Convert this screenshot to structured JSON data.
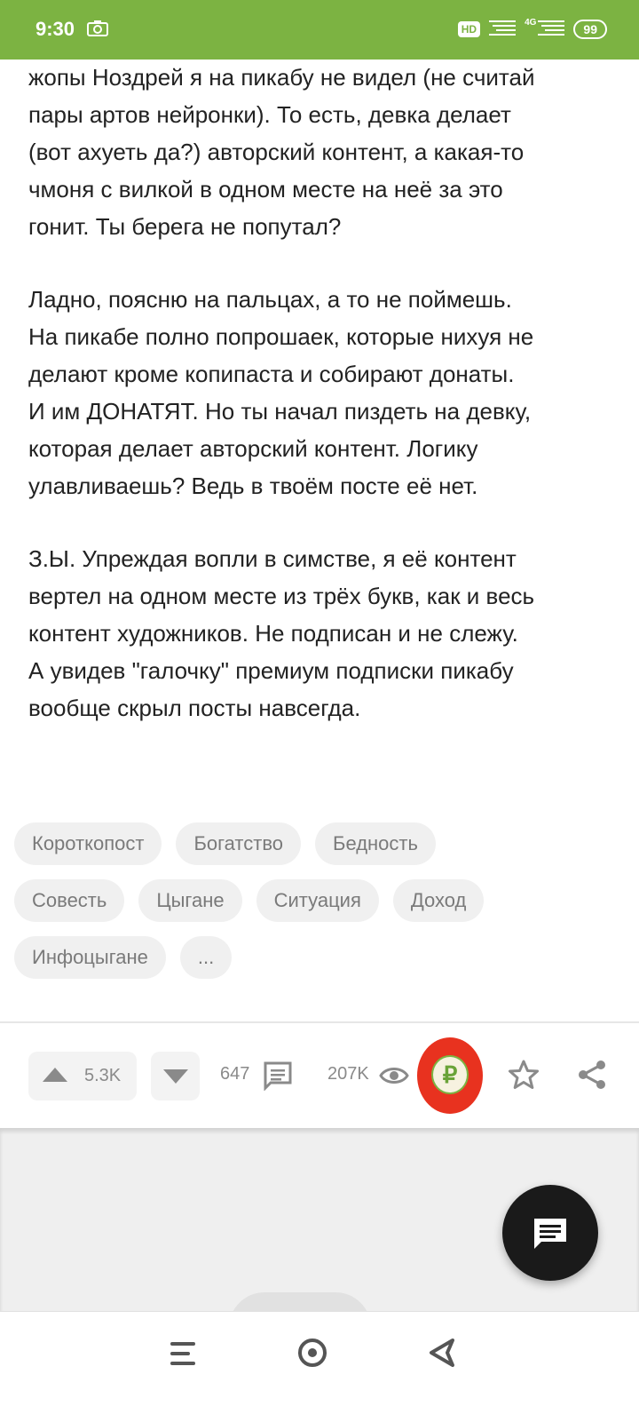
{
  "status_bar": {
    "time": "9:30",
    "hd": "HD",
    "network": "4G",
    "battery": "99"
  },
  "content": {
    "paragraphs": [
      "жопы Ноздрей я на пикабу не видел (не считай\nпары артов нейронки). То есть, девка делает\n(вот ахуеть да?) авторский контент, а какая-то\nчмоня с вилкой в одном месте на неё за это\nгонит. Ты берега не попутал?",
      "Ладно, поясню на пальцах, а то не поймешь.\nНа пикабе полно попрошаек, которые нихуя не\nделают кроме копипаста и собирают донаты.\nИ им ДОНАТЯТ. Но ты начал пиздеть на девку,\nкоторая делает авторский контент. Логику\nулавливаешь? Ведь в твоём посте её нет.",
      "З.Ы. Упреждая вопли в симстве, я её контент\nвертел на одном месте из трёх букв, как и весь\nконтент художников. Не подписан и не слежу.\nА увидев \"галочку\" премиум подписки пикабу\nвообще скрыл посты навсегда."
    ]
  },
  "tags": [
    "Короткопост",
    "Богатство",
    "Бедность",
    "Совесть",
    "Цыгане",
    "Ситуация",
    "Доход",
    "Инфоцыгане",
    "..."
  ],
  "actions": {
    "upvotes": "5.3K",
    "comments": "647",
    "views": "207K",
    "donate_symbol": "₽"
  },
  "colors": {
    "brand_green": "#7cb342",
    "donate_highlight": "#e8321f",
    "fab": "#1a1a1a"
  }
}
